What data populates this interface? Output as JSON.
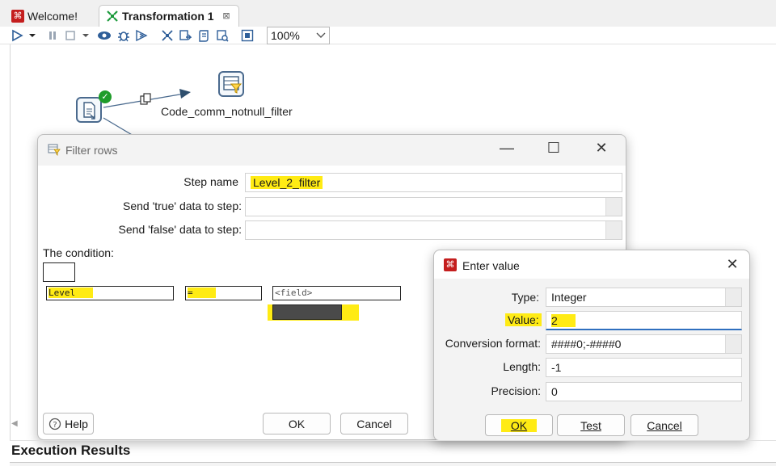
{
  "tabs": {
    "welcome": "Welcome!",
    "transformation": "Transformation 1",
    "close_glyph": "⊠"
  },
  "toolbar": {
    "zoom": "100%"
  },
  "canvas": {
    "filter_step_label": "Code_comm_notnull_filter",
    "hop_icon": "copy-rows-icon"
  },
  "filter_rows": {
    "title": "Filter rows",
    "step_name_label": "Step name",
    "step_name_value": "Level_2_filter",
    "send_true_label": "Send 'true' data to step:",
    "send_true_value": "",
    "send_false_label": "Send 'false' data to step:",
    "send_false_value": "",
    "condition_label": "The condition:",
    "cond_field": "Level",
    "cond_operator": "=",
    "cond_compare": "<field>",
    "help_label": "Help",
    "ok_label": "OK",
    "cancel_label": "Cancel"
  },
  "enter_value": {
    "title": "Enter value",
    "type_label": "Type:",
    "type_value": "Integer",
    "value_label": "Value:",
    "value_value": "2",
    "format_label": "Conversion format:",
    "format_value": "####0;-####0",
    "length_label": "Length:",
    "length_value": "-1",
    "precision_label": "Precision:",
    "precision_value": "0",
    "ok_label": "OK",
    "test_label": "Test",
    "cancel_label": "Cancel"
  },
  "execution_results_title": "Execution Results",
  "colors": {
    "highlight": "#ffeb14",
    "pdi_red": "#c41e1e",
    "success_green": "#1f9c2a",
    "focus_blue": "#2f6fbf"
  }
}
